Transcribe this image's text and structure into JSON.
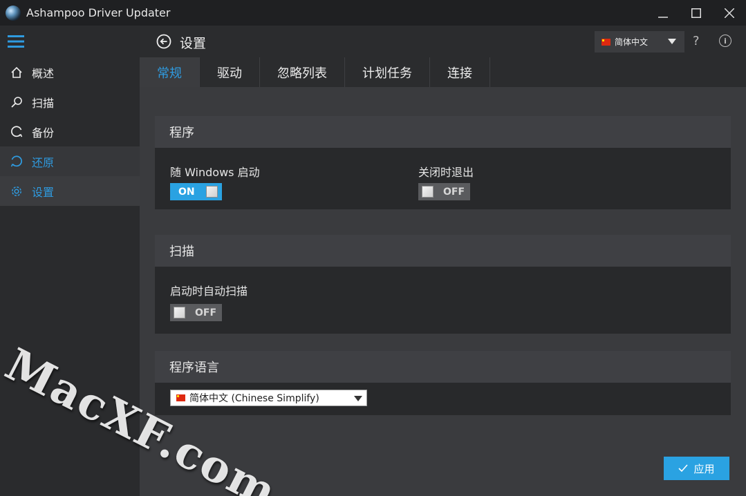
{
  "window": {
    "title": "Ashampoo Driver Updater",
    "controls": [
      "minimize",
      "maximize",
      "close"
    ]
  },
  "sidebar": {
    "items": [
      {
        "label": "概述",
        "icon": "home-icon"
      },
      {
        "label": "扫描",
        "icon": "search-icon"
      },
      {
        "label": "备份",
        "icon": "backup-icon"
      },
      {
        "label": "还原",
        "icon": "restore-icon"
      },
      {
        "label": "设置",
        "icon": "gear-icon"
      }
    ],
    "selected": "设置"
  },
  "header": {
    "title": "设置",
    "language": "简体中文",
    "help": "?",
    "info": "i"
  },
  "tabs": [
    {
      "label": "常规",
      "active": true
    },
    {
      "label": "驱动",
      "active": false
    },
    {
      "label": "忽略列表",
      "active": false
    },
    {
      "label": "计划任务",
      "active": false
    },
    {
      "label": "连接",
      "active": false
    }
  ],
  "sections": {
    "program": {
      "title": "程序",
      "start_with_windows": {
        "label": "随 Windows 启动",
        "state": "ON"
      },
      "exit_on_close": {
        "label": "关闭时退出",
        "state": "OFF"
      }
    },
    "scan": {
      "title": "扫描",
      "auto_scan": {
        "label": "启动时自动扫描",
        "state": "OFF"
      }
    },
    "language": {
      "title": "程序语言",
      "selected": "简体中文 (Chinese Simplify)"
    }
  },
  "apply_label": "应用",
  "watermark": "MacXF.com",
  "colors": {
    "accent": "#2aa2e2",
    "selected_text": "#2f9be0",
    "background": "#3a3b3e",
    "panel": "#28292b"
  }
}
